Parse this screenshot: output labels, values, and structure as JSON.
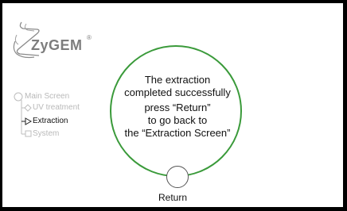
{
  "brand": {
    "name": "ZyGEM",
    "registered": "®"
  },
  "nav": {
    "items": [
      {
        "label": "Main Screen",
        "state": "inactive",
        "color": "#b9b9b9"
      },
      {
        "label": "UV treatment",
        "state": "inactive",
        "color": "#b9b9b9"
      },
      {
        "label": "Extraction",
        "state": "current",
        "color": "#111111"
      },
      {
        "label": "System",
        "state": "inactive",
        "color": "#b9b9b9"
      }
    ]
  },
  "message": {
    "lines": [
      "The extraction",
      "completed successfully",
      "press “Return”",
      "to go back to",
      "the “Extraction Screen”"
    ]
  },
  "return_button": {
    "label": "Return"
  },
  "colors": {
    "circle_border": "#3a9a3a",
    "logo_gray": "#8a8a8a",
    "frame": "#000000"
  }
}
